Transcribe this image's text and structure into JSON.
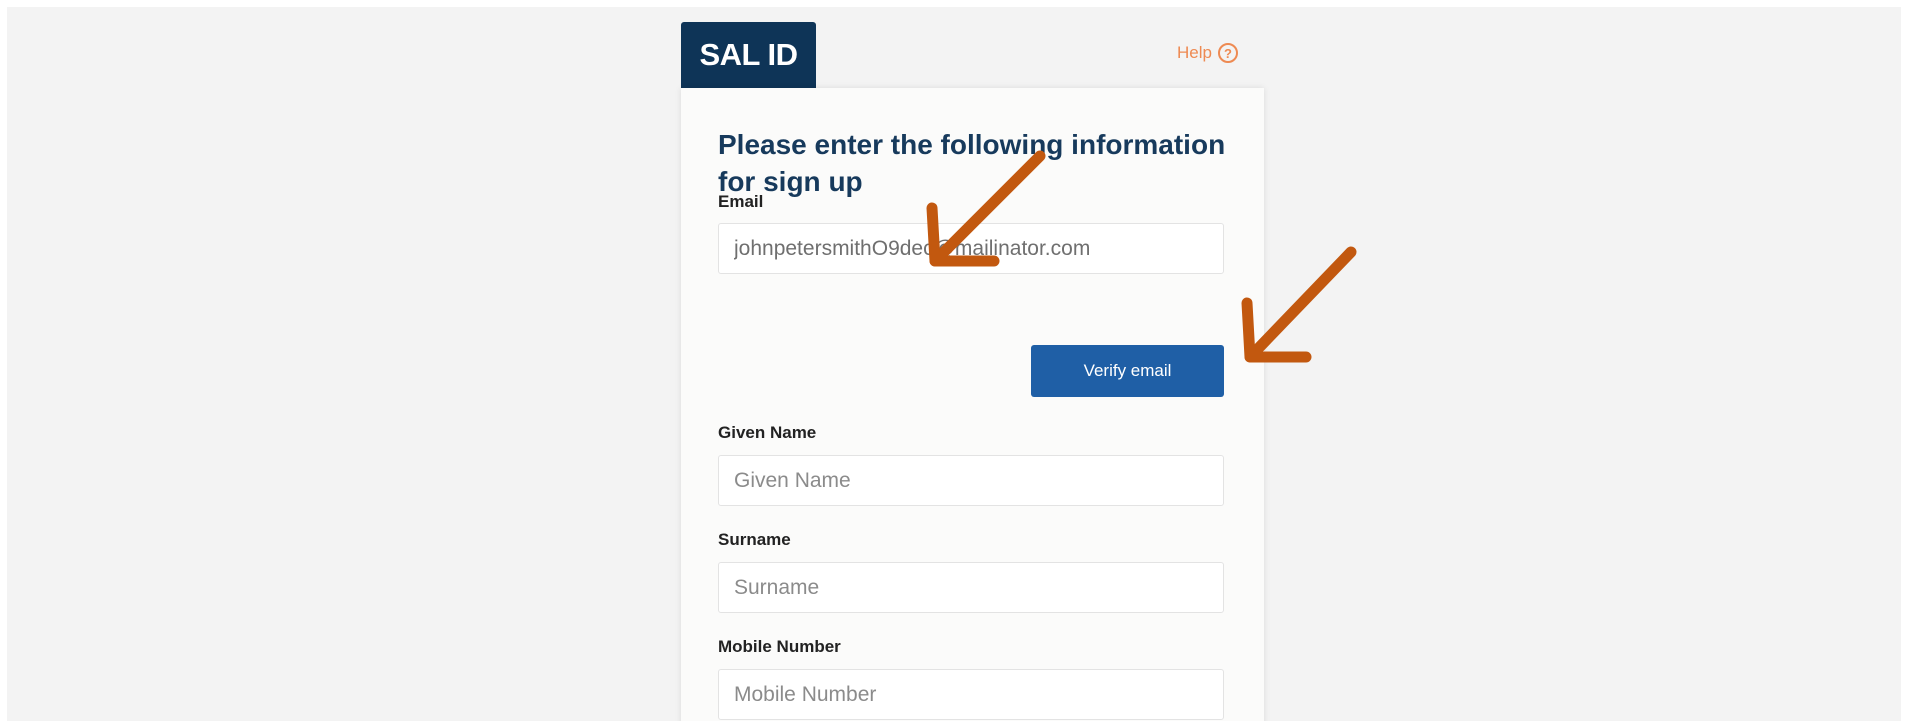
{
  "brand": {
    "logo_text": "SAL ID"
  },
  "help": {
    "label": "Help",
    "icon": "question-circle-icon",
    "color": "#ee8a52"
  },
  "form": {
    "title": "Please enter the following information for sign up",
    "email": {
      "label": "Email",
      "value": "johnpetersmithO9dec@mailinator.com"
    },
    "verify_button_label": "Verify email",
    "given_name": {
      "label": "Given Name",
      "placeholder": "Given Name"
    },
    "surname": {
      "label": "Surname",
      "placeholder": "Surname"
    },
    "mobile_number": {
      "label": "Mobile Number",
      "placeholder": "Mobile Number"
    }
  },
  "colors": {
    "brand_navy": "#0e3457",
    "title_blue": "#173a5c",
    "button_blue": "#1f5fa6",
    "annotation_arrow": "#c2580f",
    "background": "#f3f3f3"
  }
}
